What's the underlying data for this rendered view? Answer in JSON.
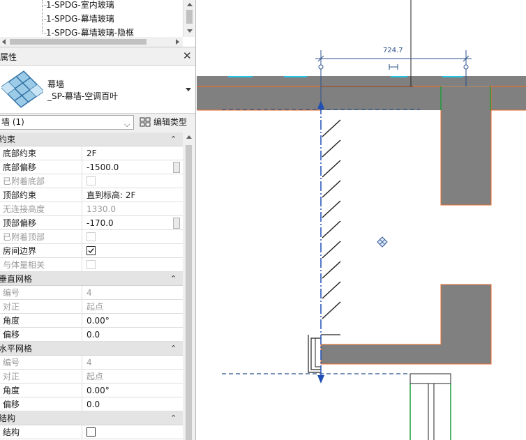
{
  "project_browser": {
    "items": [
      "1-SPDG-室内玻璃",
      "1-SPDG-幕墙玻璃",
      "1-SPDG-幕墙玻璃-隐框"
    ]
  },
  "properties": {
    "title": "属性",
    "type_family": "幕墙",
    "type_name": "_SP-幕墙-空调百叶",
    "filter_label": "墙 (1)",
    "edit_type_label": "编辑类型",
    "groups": {
      "constraints": {
        "label": "约束",
        "rows": [
          {
            "label": "底部约束",
            "value": "2F"
          },
          {
            "label": "底部偏移",
            "value": "-1500.0"
          },
          {
            "label": "已附着底部",
            "value": ""
          },
          {
            "label": "顶部约束",
            "value": "直到标高: 2F"
          },
          {
            "label": "无连接高度",
            "value": "1330.0"
          },
          {
            "label": "顶部偏移",
            "value": "-170.0"
          },
          {
            "label": "已附着顶部",
            "value": ""
          },
          {
            "label": "房间边界",
            "value": ""
          },
          {
            "label": "与体量相关",
            "value": ""
          }
        ]
      },
      "vertical_grid": {
        "label": "垂直网格",
        "rows": [
          {
            "label": "编号",
            "value": "4"
          },
          {
            "label": "对正",
            "value": "起点"
          },
          {
            "label": "角度",
            "value": "0.00°"
          },
          {
            "label": "偏移",
            "value": "0.0"
          }
        ]
      },
      "horizontal_grid": {
        "label": "水平网格",
        "rows": [
          {
            "label": "编号",
            "value": "4"
          },
          {
            "label": "对正",
            "value": "起点"
          },
          {
            "label": "角度",
            "value": "0.00°"
          },
          {
            "label": "偏移",
            "value": "0.0"
          }
        ]
      },
      "structure": {
        "label": "结构",
        "rows": [
          {
            "label": "结构",
            "value": ""
          }
        ]
      }
    }
  },
  "drawing": {
    "dimension_value": "724.7"
  },
  "colors": {
    "wall_fill": "#808080",
    "wall_edge": "#e86b2a",
    "annotation_blue": "#2b4f8a",
    "cyan_highlight": "#27c6e6",
    "green_edge": "#1a9c3a"
  }
}
